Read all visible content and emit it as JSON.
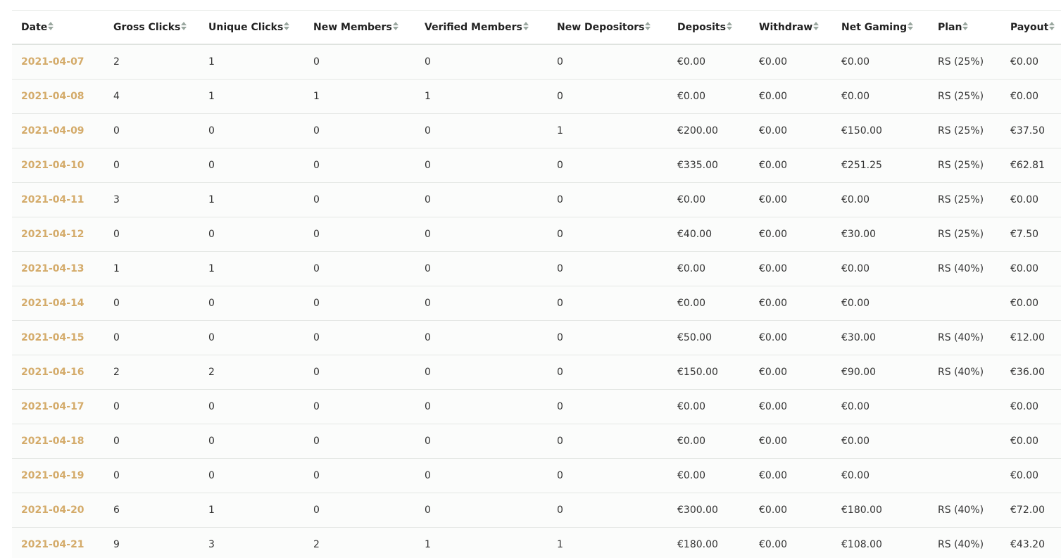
{
  "colors": {
    "date_link": "#d4ab6a",
    "sort_arrow": "#9aa79f"
  },
  "table": {
    "columns": [
      {
        "key": "date",
        "label": "Date"
      },
      {
        "key": "gross",
        "label": "Gross Clicks"
      },
      {
        "key": "unique",
        "label": "Unique Clicks"
      },
      {
        "key": "members",
        "label": "New Members"
      },
      {
        "key": "verified",
        "label": "Verified Members"
      },
      {
        "key": "depositors",
        "label": "New Depositors"
      },
      {
        "key": "deposits",
        "label": "Deposits"
      },
      {
        "key": "withdraw",
        "label": "Withdraw"
      },
      {
        "key": "net",
        "label": "Net Gaming"
      },
      {
        "key": "plan",
        "label": "Plan"
      },
      {
        "key": "payout",
        "label": "Payout"
      }
    ],
    "rows": [
      [
        "2021-04-07",
        "2",
        "1",
        "0",
        "0",
        "0",
        "€0.00",
        "€0.00",
        "€0.00",
        "RS (25%)",
        "€0.00"
      ],
      [
        "2021-04-08",
        "4",
        "1",
        "1",
        "1",
        "0",
        "€0.00",
        "€0.00",
        "€0.00",
        "RS (25%)",
        "€0.00"
      ],
      [
        "2021-04-09",
        "0",
        "0",
        "0",
        "0",
        "1",
        "€200.00",
        "€0.00",
        "€150.00",
        "RS (25%)",
        "€37.50"
      ],
      [
        "2021-04-10",
        "0",
        "0",
        "0",
        "0",
        "0",
        "€335.00",
        "€0.00",
        "€251.25",
        "RS (25%)",
        "€62.81"
      ],
      [
        "2021-04-11",
        "3",
        "1",
        "0",
        "0",
        "0",
        "€0.00",
        "€0.00",
        "€0.00",
        "RS (25%)",
        "€0.00"
      ],
      [
        "2021-04-12",
        "0",
        "0",
        "0",
        "0",
        "0",
        "€40.00",
        "€0.00",
        "€30.00",
        "RS (25%)",
        "€7.50"
      ],
      [
        "2021-04-13",
        "1",
        "1",
        "0",
        "0",
        "0",
        "€0.00",
        "€0.00",
        "€0.00",
        "RS (40%)",
        "€0.00"
      ],
      [
        "2021-04-14",
        "0",
        "0",
        "0",
        "0",
        "0",
        "€0.00",
        "€0.00",
        "€0.00",
        "",
        "€0.00"
      ],
      [
        "2021-04-15",
        "0",
        "0",
        "0",
        "0",
        "0",
        "€50.00",
        "€0.00",
        "€30.00",
        "RS (40%)",
        "€12.00"
      ],
      [
        "2021-04-16",
        "2",
        "2",
        "0",
        "0",
        "0",
        "€150.00",
        "€0.00",
        "€90.00",
        "RS (40%)",
        "€36.00"
      ],
      [
        "2021-04-17",
        "0",
        "0",
        "0",
        "0",
        "0",
        "€0.00",
        "€0.00",
        "€0.00",
        "",
        "€0.00"
      ],
      [
        "2021-04-18",
        "0",
        "0",
        "0",
        "0",
        "0",
        "€0.00",
        "€0.00",
        "€0.00",
        "",
        "€0.00"
      ],
      [
        "2021-04-19",
        "0",
        "0",
        "0",
        "0",
        "0",
        "€0.00",
        "€0.00",
        "€0.00",
        "",
        "€0.00"
      ],
      [
        "2021-04-20",
        "6",
        "1",
        "0",
        "0",
        "0",
        "€300.00",
        "€0.00",
        "€180.00",
        "RS (40%)",
        "€72.00"
      ],
      [
        "2021-04-21",
        "9",
        "3",
        "2",
        "1",
        "1",
        "€180.00",
        "€0.00",
        "€108.00",
        "RS (40%)",
        "€43.20"
      ]
    ]
  }
}
